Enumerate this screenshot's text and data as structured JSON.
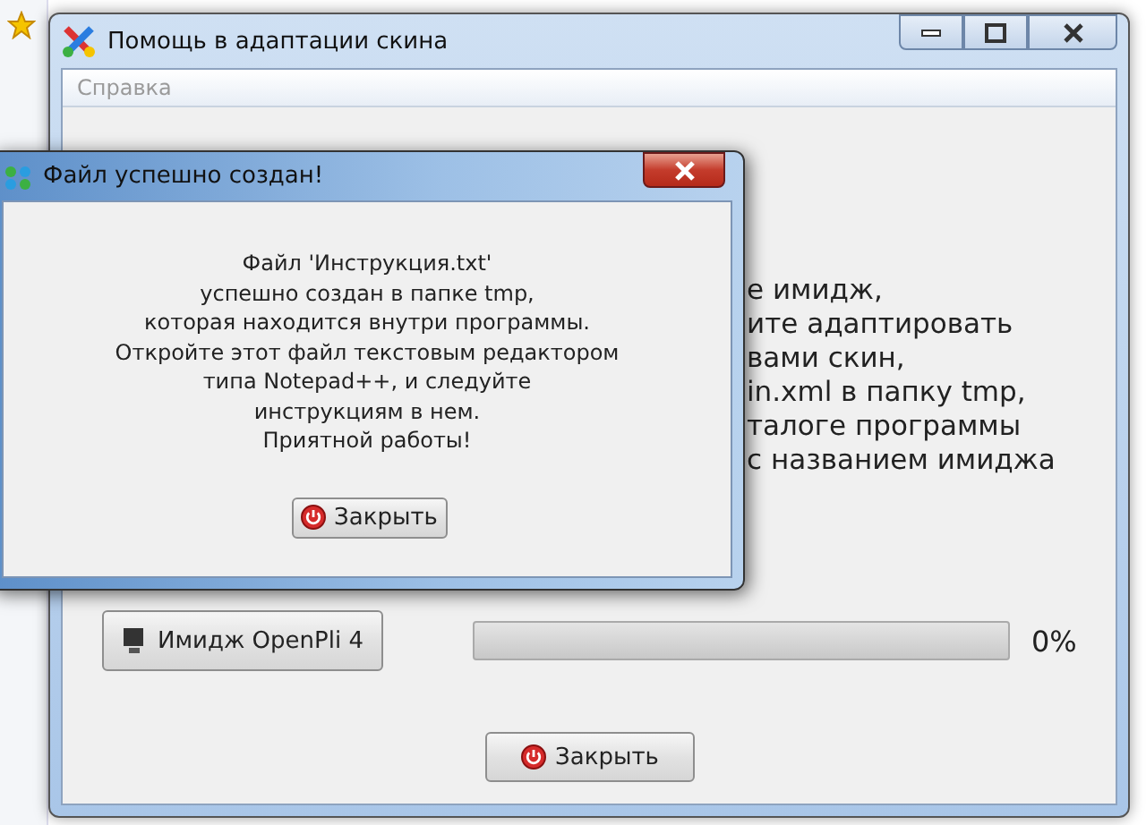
{
  "main_window": {
    "title": "Помощь в адаптации скина",
    "menu": [
      "Справка"
    ],
    "text_lines": [
      "е имидж,",
      "ите адаптировать",
      "вами скин,",
      "in.xml в папку tmp,",
      "талоге программы",
      "с названием имиджа"
    ],
    "image_button": "Имидж OpenPli 4",
    "progress": {
      "level": 0,
      "reading": "0%"
    },
    "close_button": "Закрыть"
  },
  "dialog": {
    "title": "Файл успешно создан!",
    "message_lines": [
      "Файл 'Инструкция.txt'",
      "успешно создан в папке tmp,",
      "которая находится внутри программы.",
      "Откройте этот файл текстовым редактором",
      "типа Notepad++, и следуйте",
      "инструкциям в нем.",
      "Приятной работы!"
    ],
    "close_button": "Закрыть"
  }
}
